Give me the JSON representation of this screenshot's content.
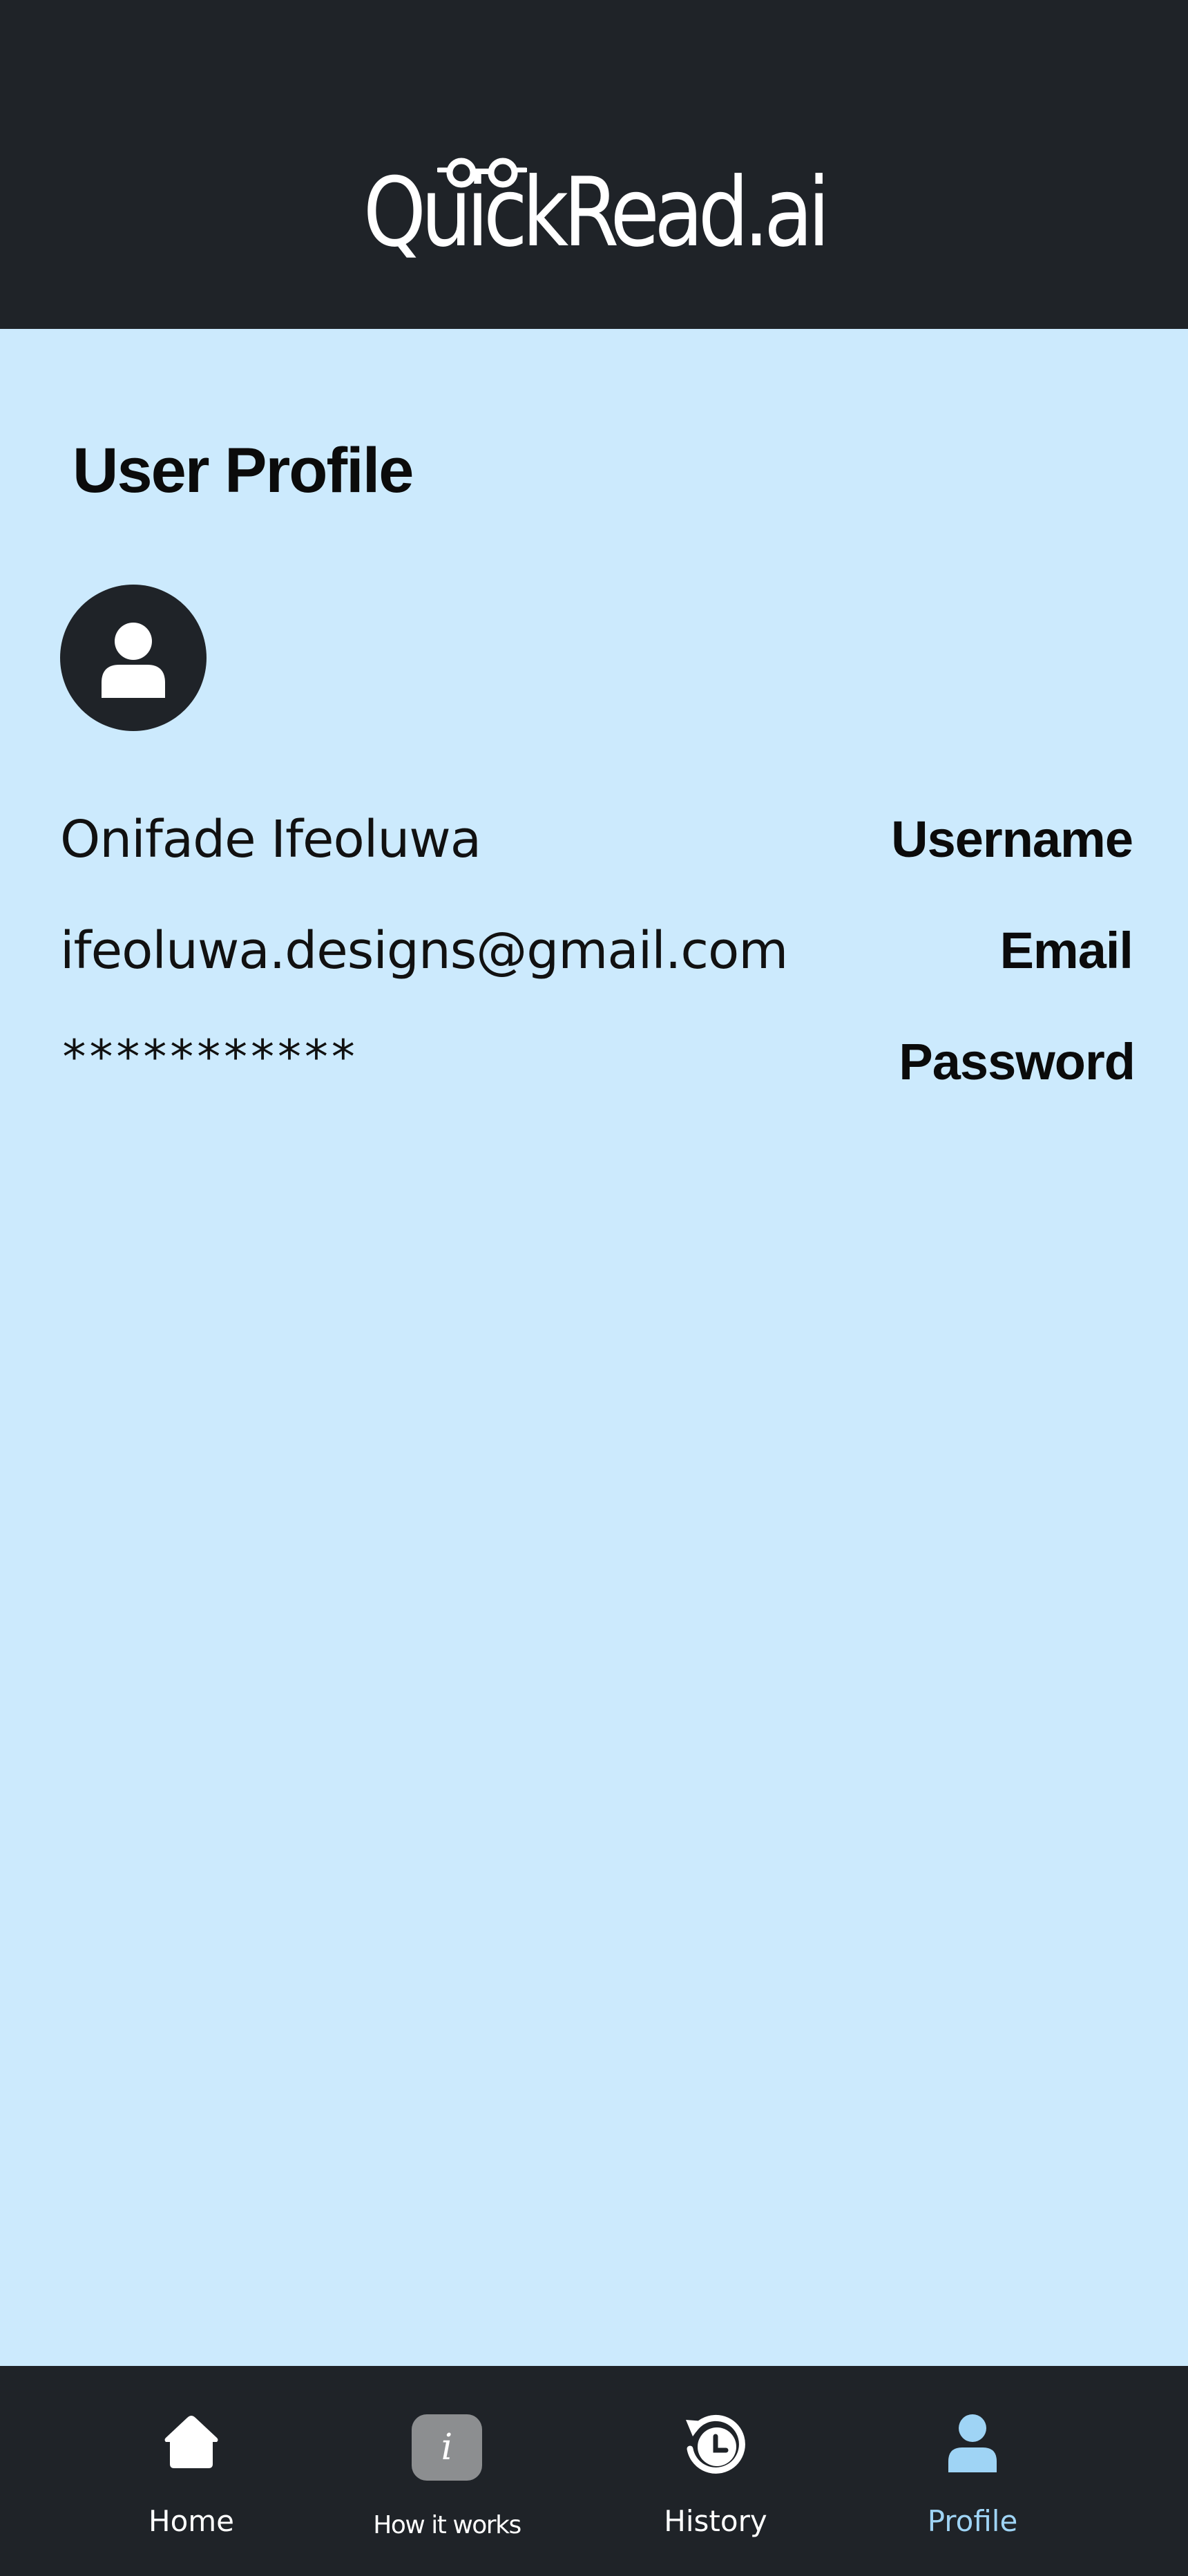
{
  "header": {
    "logo_text": "QuickRead.ai"
  },
  "page": {
    "title": "User Profile"
  },
  "profile": {
    "avatar_icon": "user-icon",
    "fields": [
      {
        "label": "Username",
        "value": "Onifade Ifeoluwa"
      },
      {
        "label": "Email",
        "value": "ifeoluwa.designs@gmail.com"
      },
      {
        "label": "Password",
        "value": "***********"
      }
    ]
  },
  "bottom_nav": {
    "items": [
      {
        "label": "Home",
        "icon": "home-icon"
      },
      {
        "label": "How it works",
        "icon": "info-icon"
      },
      {
        "label": "History",
        "icon": "history-icon"
      },
      {
        "label": "Profile",
        "icon": "user-icon",
        "active": true
      }
    ]
  },
  "colors": {
    "background": "#CCEAFD",
    "header": "#1F2328",
    "active_nav": "#9FD4F5"
  }
}
